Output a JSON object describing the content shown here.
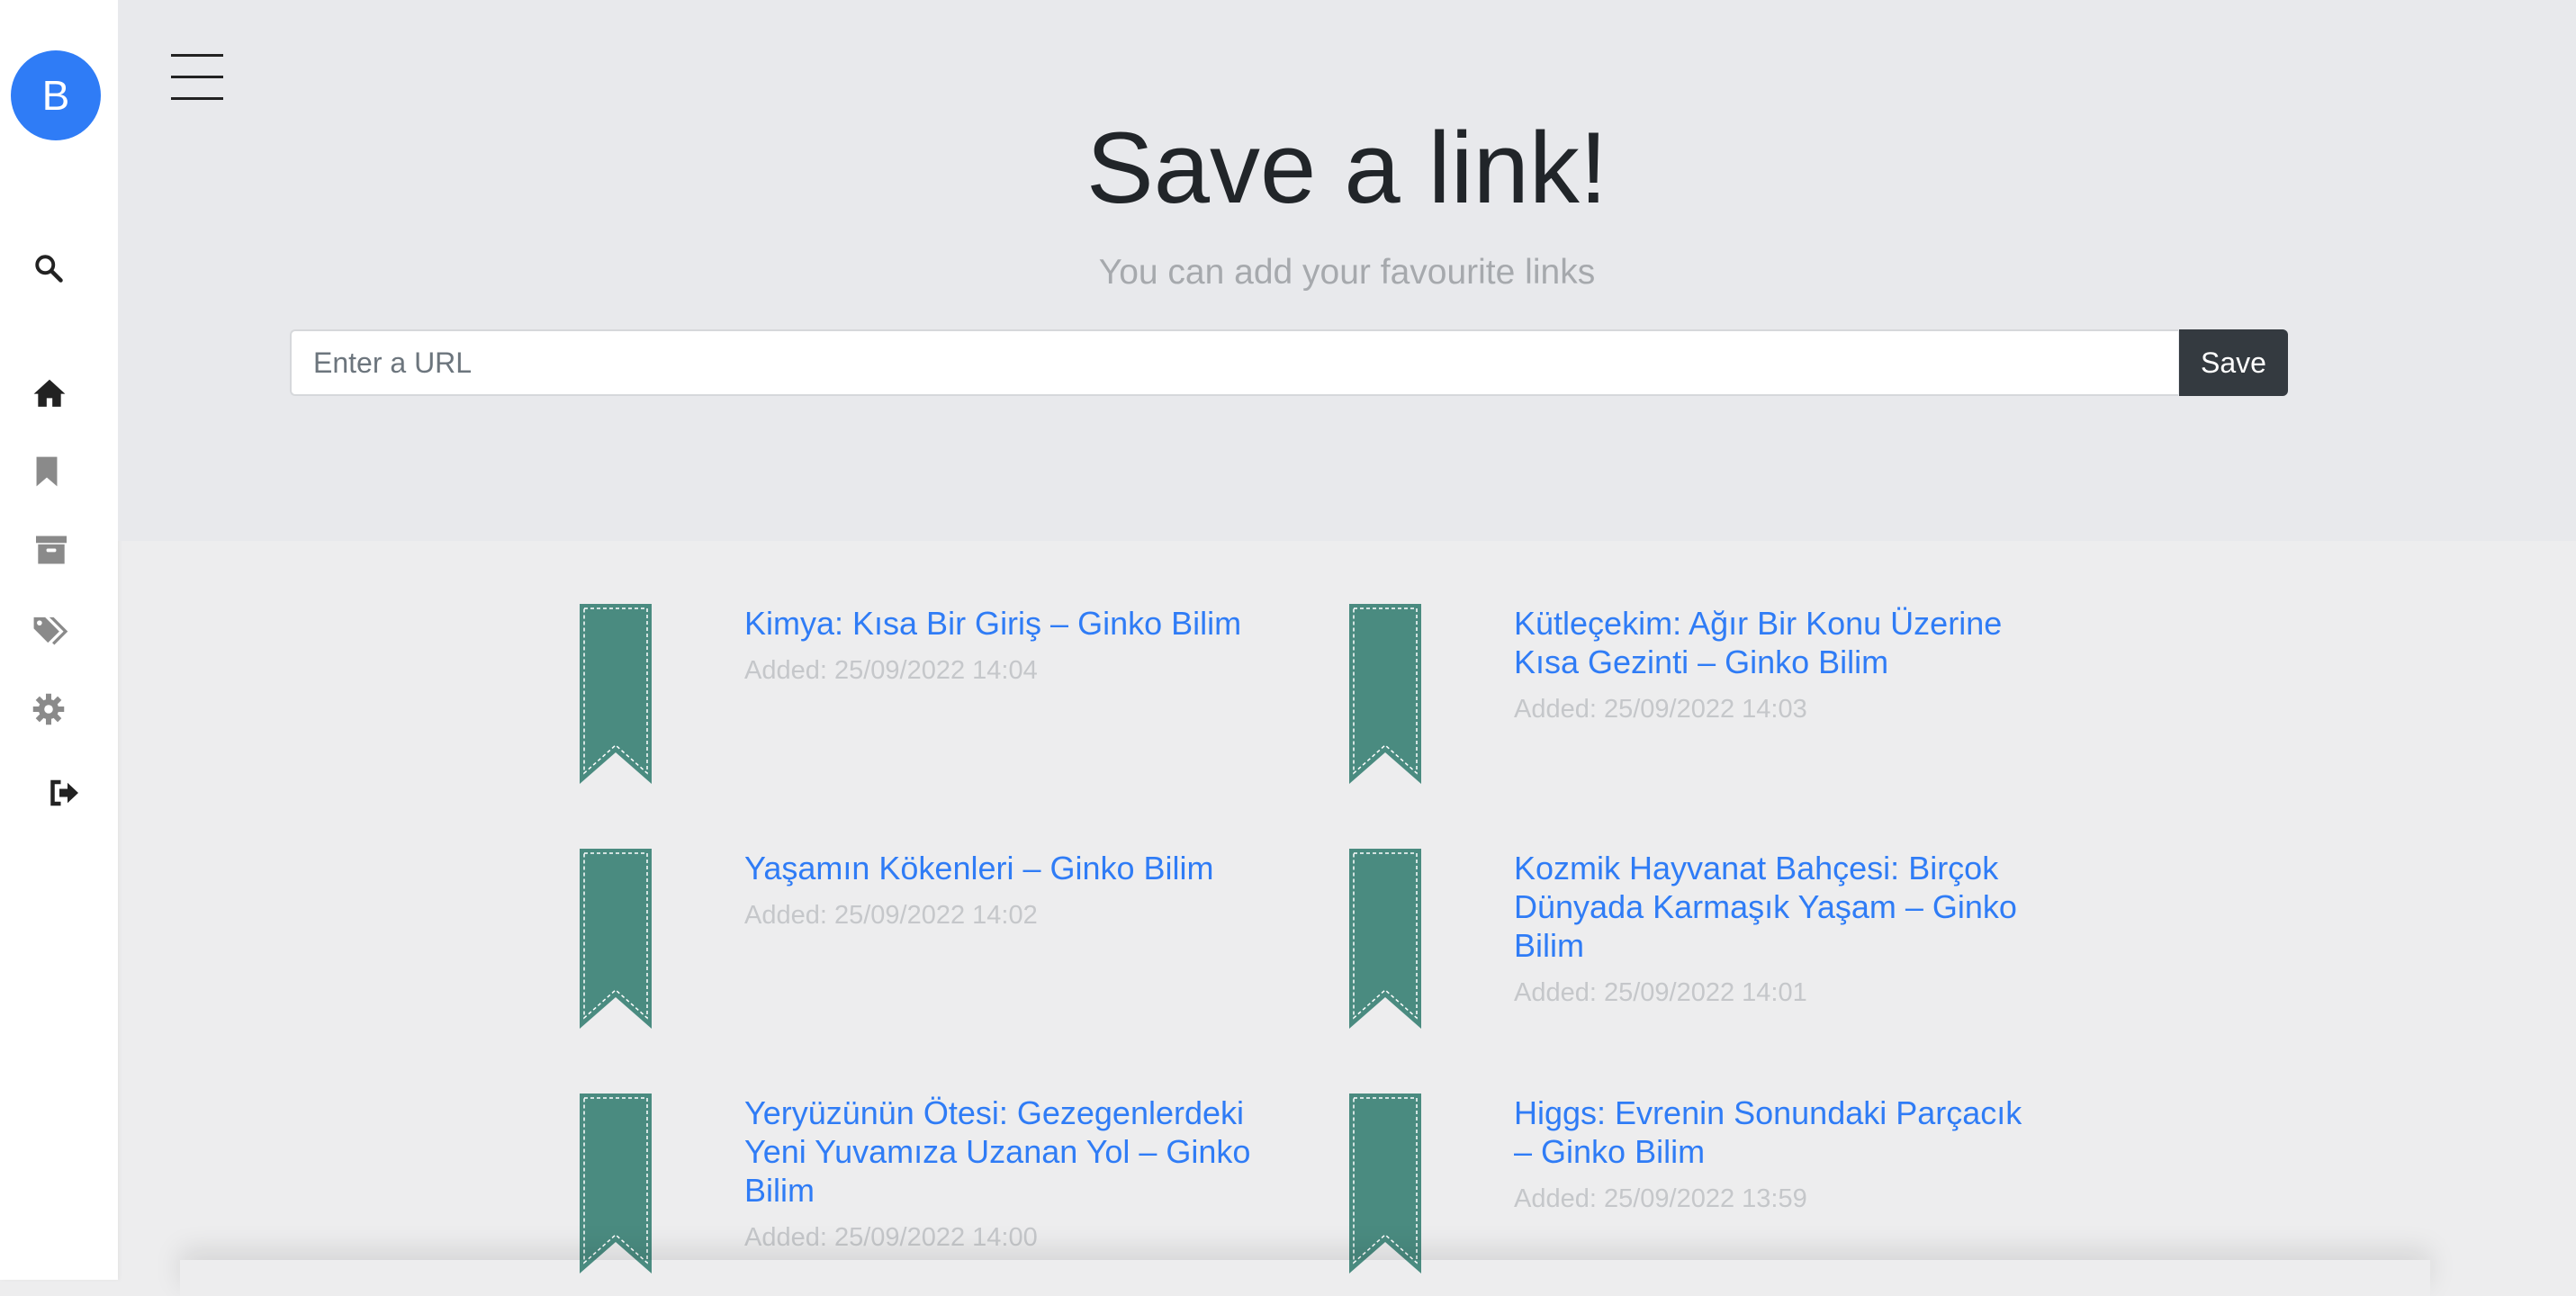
{
  "sidebar": {
    "avatar_letter": "B",
    "icons": [
      "search-icon",
      "home-icon",
      "bookmark-icon",
      "archive-icon",
      "tags-icon",
      "settings-icon",
      "logout-icon"
    ]
  },
  "header": {
    "title": "Save a link!",
    "subtitle": "You can add your favourite links",
    "url_placeholder": "Enter a URL",
    "url_value": "",
    "save_label": "Save"
  },
  "links": [
    {
      "title": "Kimya: Kısa Bir Giriş – Ginko Bilim",
      "date": "Added: 25/09/2022 14:04"
    },
    {
      "title": "Kütleçekim: Ağır Bir Konu Üzerine Kısa Gezinti – Ginko Bilim",
      "date": "Added: 25/09/2022 14:03"
    },
    {
      "title": "Yaşamın Kökenleri – Ginko Bilim",
      "date": "Added: 25/09/2022 14:02"
    },
    {
      "title": "Kozmik Hayvanat Bahçesi: Birçok Dünyada Karmaşık Yaşam – Ginko Bilim",
      "date": "Added: 25/09/2022 14:01"
    },
    {
      "title": "Yeryüzünün Ötesi: Gezegenlerdeki Yeni Yuvamıza Uzanan Yol – Ginko Bilim",
      "date": "Added: 25/09/2022 14:00"
    },
    {
      "title": "Higgs: Evrenin Sonundaki Parçacık – Ginko Bilim",
      "date": "Added: 25/09/2022 13:59"
    }
  ],
  "colors": {
    "accent": "#2f7cf6",
    "ribbon": "#4a8b80",
    "save_button": "#343a40"
  }
}
